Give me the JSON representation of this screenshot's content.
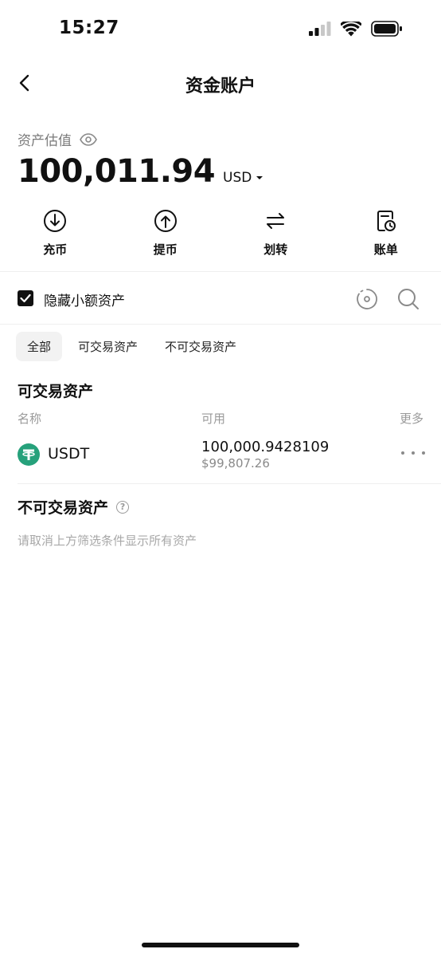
{
  "status_bar": {
    "time": "15:27"
  },
  "nav": {
    "title": "资金账户"
  },
  "estimate": {
    "label": "资产估值",
    "balance": "100,011.94",
    "currency": "USD"
  },
  "actions": [
    {
      "label": "充币",
      "icon": "deposit-icon"
    },
    {
      "label": "提币",
      "icon": "withdraw-icon"
    },
    {
      "label": "划转",
      "icon": "transfer-icon"
    },
    {
      "label": "账单",
      "icon": "bill-icon"
    }
  ],
  "filter": {
    "hide_small_label": "隐藏小额资产",
    "hide_small_checked": true
  },
  "tabs": [
    {
      "label": "全部",
      "active": true
    },
    {
      "label": "可交易资产",
      "active": false
    },
    {
      "label": "不可交易资产",
      "active": false
    }
  ],
  "tradable": {
    "title": "可交易资产",
    "columns": {
      "name": "名称",
      "available": "可用",
      "more": "更多"
    },
    "assets": [
      {
        "name": "USDT",
        "available": "100,000.9428109",
        "usd_value": "$99,807.26",
        "brand_color": "#26a17b"
      }
    ]
  },
  "non_tradable": {
    "title": "不可交易资产",
    "hint": "请取消上方筛选条件显示所有资产"
  }
}
